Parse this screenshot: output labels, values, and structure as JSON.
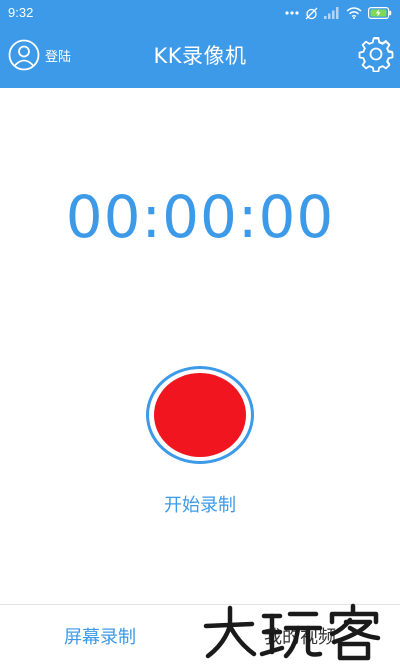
{
  "status_bar": {
    "time": "9:32"
  },
  "header": {
    "login_label": "登陆",
    "title": "KK录像机",
    "icons": {
      "avatar": "user-avatar-icon",
      "settings": "gear-icon"
    }
  },
  "timer": "00:00:00",
  "record": {
    "label": "开始录制"
  },
  "tabs": [
    {
      "label": "屏幕录制",
      "active": true
    },
    {
      "label": "我的视频",
      "active": false
    }
  ],
  "watermark": {
    "text": "大玩客"
  },
  "colors": {
    "primary": "#3d9ae8",
    "record": "#f0151e",
    "text_dark": "#333333"
  }
}
